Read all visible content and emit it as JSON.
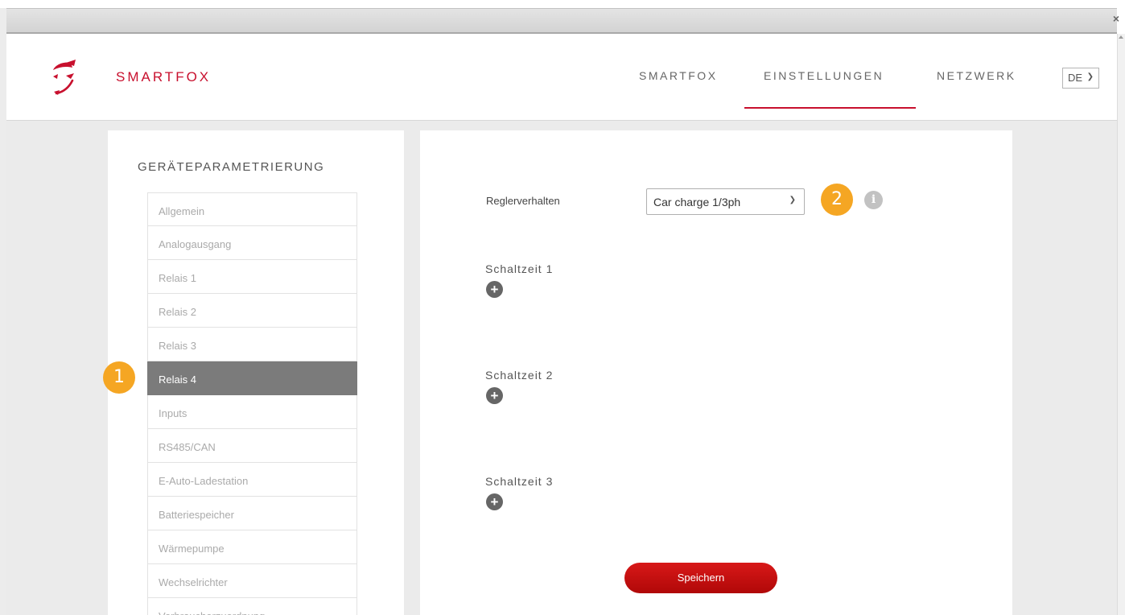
{
  "window": {
    "close_label": "×"
  },
  "header": {
    "brand": "SMARTFOX",
    "nav": [
      "SMARTFOX",
      "EINSTELLUNGEN",
      "NETZWERK"
    ],
    "active_nav": "EINSTELLUNGEN",
    "language": "DE",
    "accent_color": "#c8102e"
  },
  "sidebar": {
    "title": "GERÄTEPARAMETRIERUNG",
    "items": [
      {
        "label": "Allgemein"
      },
      {
        "label": "Analogausgang"
      },
      {
        "label": "Relais 1"
      },
      {
        "label": "Relais 2"
      },
      {
        "label": "Relais 3"
      },
      {
        "label": "Relais 4",
        "active": true
      },
      {
        "label": "Inputs"
      },
      {
        "label": "RS485/CAN"
      },
      {
        "label": "E-Auto-Ladestation"
      },
      {
        "label": "Batteriespeicher"
      },
      {
        "label": "Wärmepumpe"
      },
      {
        "label": "Wechselrichter"
      },
      {
        "label": "Verbraucherzuordnung"
      }
    ]
  },
  "main": {
    "regler_label": "Reglerverhalten",
    "regler_value": "Car charge 1/3ph",
    "info_icon": "i",
    "schaltzeiten": [
      "Schaltzeit 1",
      "Schaltzeit 2",
      "Schaltzeit 3"
    ],
    "add_icon": "+",
    "save_label": "Speichern",
    "save_color": "#c8102e"
  },
  "annotations": {
    "badge1": "1",
    "badge2": "2",
    "badge_color": "#f5a623"
  }
}
